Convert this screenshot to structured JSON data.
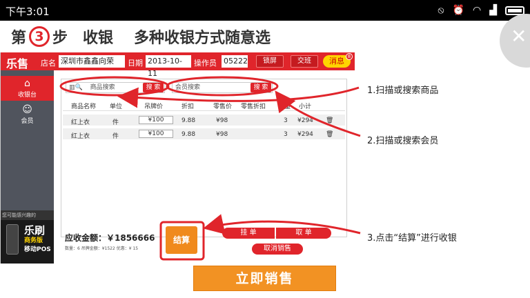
{
  "status_bar": {
    "time": "下午3:01",
    "icons": [
      "notification-off-icon",
      "alarm-icon",
      "wifi-icon",
      "signal-icon",
      "battery-icon"
    ]
  },
  "headline": {
    "prefix": "第",
    "step": "3",
    "suffix": "步",
    "title": "收银",
    "desc": "多种收银方式随意选"
  },
  "app": {
    "logo": "乐售",
    "store_label": "店名",
    "store_value": "深圳市鑫鑫向荣",
    "date_label": "日期",
    "date_value": "2013-10-11",
    "operator_label": "操作员",
    "operator_value": "05222",
    "lock_label": "锁屏",
    "handover_label": "交班",
    "message_label": "消息",
    "message_badge": "8"
  },
  "sidebar": {
    "items": [
      {
        "label": "收银台",
        "icon": "cashier-icon"
      },
      {
        "label": "会员",
        "icon": "member-icon"
      }
    ],
    "ad": {
      "top_text": "您可能感兴趣的",
      "brand": "乐刷",
      "line1": "商务版",
      "line2": "移动POS"
    }
  },
  "search": {
    "product_placeholder": "商品搜索",
    "product_button": "搜 索",
    "member_placeholder": "会员搜索",
    "member_button": "搜 索"
  },
  "table": {
    "headers": [
      "商品名称",
      "单位",
      "吊牌价",
      "折扣",
      "零售价",
      "零售折扣",
      "数量",
      "小计"
    ],
    "rows": [
      {
        "name": "红上衣",
        "unit": "件",
        "tag_price": "¥100",
        "discount": "9.88",
        "retail": "¥98",
        "qty": "3",
        "subtotal": "¥294"
      },
      {
        "name": "红上衣",
        "unit": "件",
        "tag_price": "¥100",
        "discount": "9.88",
        "retail": "¥98",
        "qty": "3",
        "subtotal": "¥294"
      }
    ]
  },
  "footer": {
    "amount_due": "应收金额：￥1856666",
    "summary": "数量：6   吊牌金额：¥1522   优惠：¥ 15",
    "checkout": "结算",
    "hang_order": "挂 单",
    "take_order": "取 单",
    "cancel_sale": "取消销售"
  },
  "notes": [
    "1.扫描或搜索商品",
    "2.扫描或搜索会员",
    "3.点击“结算”进行收银"
  ],
  "cta": "立即销售",
  "colors": {
    "brand_red": "#e0252b",
    "orange": "#f29223",
    "sidebar": "#50545d"
  }
}
